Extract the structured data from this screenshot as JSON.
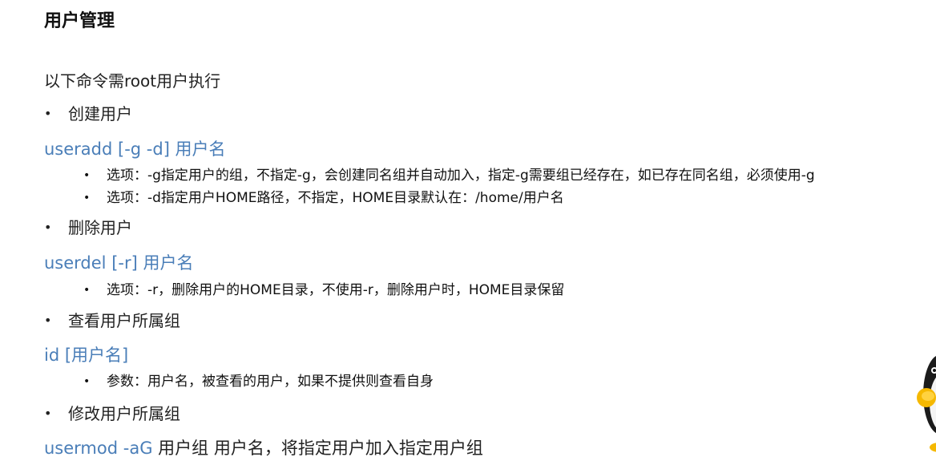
{
  "title": "用户管理",
  "intro": "以下命令需root用户执行",
  "sections": [
    {
      "bullet": "创建用户",
      "command": "useradd [-g -d] 用户名",
      "notes": [
        "选项：-g指定用户的组，不指定-g，会创建同名组并自动加入，指定-g需要组已经存在，如已存在同名组，必须使用-g",
        "选项：-d指定用户HOME路径，不指定，HOME目录默认在：/home/用户名"
      ]
    },
    {
      "bullet": "删除用户",
      "command": "userdel [-r] 用户名",
      "notes": [
        "选项：-r，删除用户的HOME目录，不使用-r，删除用户时，HOME目录保留"
      ]
    },
    {
      "bullet": "查看用户所属组",
      "command": "id [用户名]",
      "notes": [
        "参数：用户名，被查看的用户，如果不提供则查看自身"
      ]
    },
    {
      "bullet": "修改用户所属组",
      "command": "usermod -aG",
      "command_rest": " 用户组 用户名，将指定用户加入指定用户组"
    }
  ],
  "bullet_glyph": "•",
  "accent_color": "#4a7eb8",
  "mascot_icon": "penguin-icon"
}
